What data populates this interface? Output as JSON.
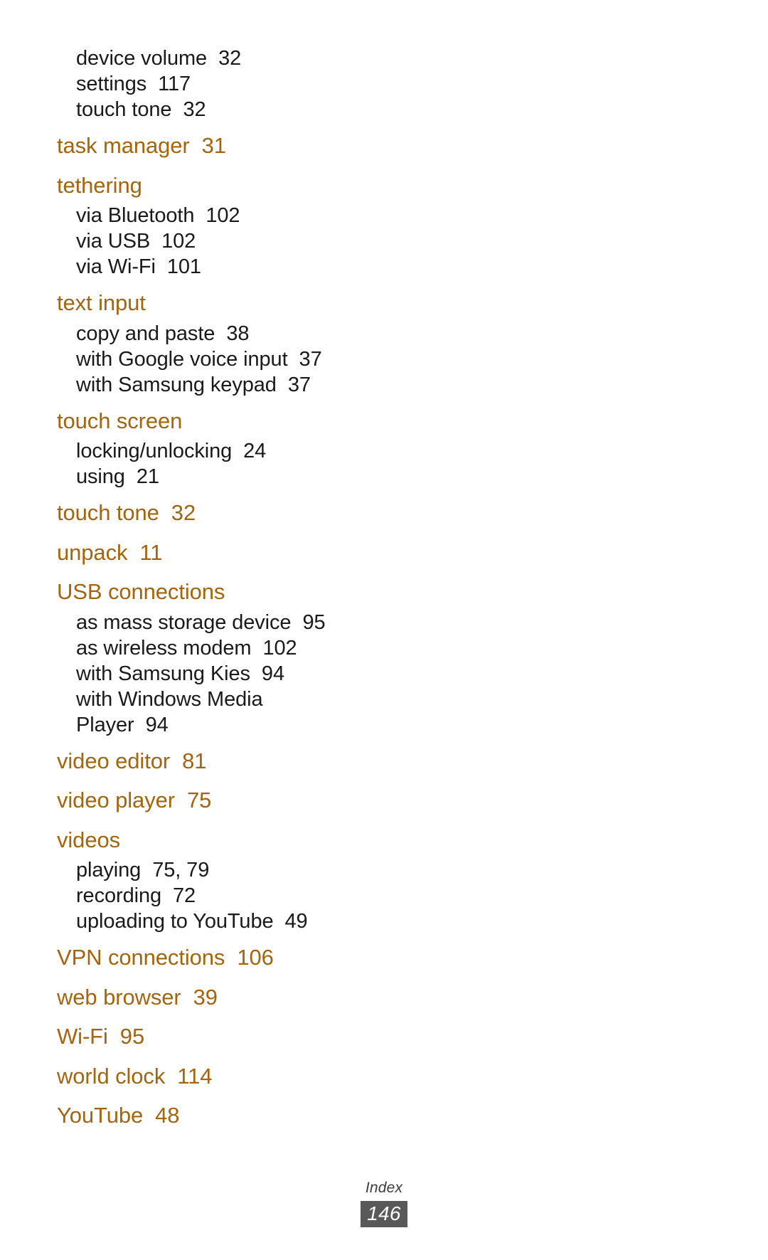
{
  "page": {
    "footer_label": "Index",
    "page_number": "146",
    "heading_color": "#A3650F",
    "subentry_color": "#1a1a1a",
    "pagenum_badge_color": "#595959"
  },
  "index": {
    "groups": [
      {
        "main": null,
        "subs": [
          {
            "label": "device volume",
            "page": "32"
          },
          {
            "label": "settings",
            "page": "117"
          },
          {
            "label": "touch tone",
            "page": "32"
          }
        ]
      },
      {
        "main": {
          "label": "task manager",
          "page": "31"
        },
        "subs": []
      },
      {
        "main": {
          "label": "tethering",
          "page": ""
        },
        "subs": [
          {
            "label": "via Bluetooth",
            "page": "102"
          },
          {
            "label": "via USB",
            "page": "102"
          },
          {
            "label": "via Wi-Fi",
            "page": "101"
          }
        ]
      },
      {
        "main": {
          "label": "text input",
          "page": ""
        },
        "subs": [
          {
            "label": "copy and paste",
            "page": "38"
          },
          {
            "label": "with Google voice input",
            "page": "37"
          },
          {
            "label": "with Samsung keypad",
            "page": "37"
          }
        ]
      },
      {
        "main": {
          "label": "touch screen",
          "page": ""
        },
        "subs": [
          {
            "label": "locking/unlocking",
            "page": "24"
          },
          {
            "label": "using",
            "page": "21"
          }
        ]
      },
      {
        "main": {
          "label": "touch tone",
          "page": "32"
        },
        "subs": []
      },
      {
        "main": {
          "label": "unpack",
          "page": "11"
        },
        "subs": []
      },
      {
        "main": {
          "label": "USB connections",
          "page": ""
        },
        "subs": [
          {
            "label": "as mass storage device",
            "page": "95"
          },
          {
            "label": "as wireless modem",
            "page": "102"
          },
          {
            "label": "with Samsung Kies",
            "page": "94"
          },
          {
            "label": "with Windows Media",
            "page": ""
          },
          {
            "label": "Player",
            "page": "94"
          }
        ]
      },
      {
        "main": {
          "label": "video editor",
          "page": "81"
        },
        "subs": []
      },
      {
        "main": {
          "label": "video player",
          "page": "75"
        },
        "subs": []
      },
      {
        "main": {
          "label": "videos",
          "page": ""
        },
        "subs": [
          {
            "label": "playing",
            "page": "75, 79"
          },
          {
            "label": "recording",
            "page": "72"
          },
          {
            "label": "uploading to YouTube",
            "page": "49"
          }
        ]
      },
      {
        "main": {
          "label": "VPN connections",
          "page": "106"
        },
        "subs": []
      },
      {
        "main": {
          "label": "web browser",
          "page": "39"
        },
        "subs": []
      },
      {
        "main": {
          "label": "Wi-Fi",
          "page": "95"
        },
        "subs": []
      },
      {
        "main": {
          "label": "world clock",
          "page": "114"
        },
        "subs": []
      },
      {
        "main": {
          "label": "YouTube",
          "page": "48"
        },
        "subs": []
      }
    ]
  }
}
